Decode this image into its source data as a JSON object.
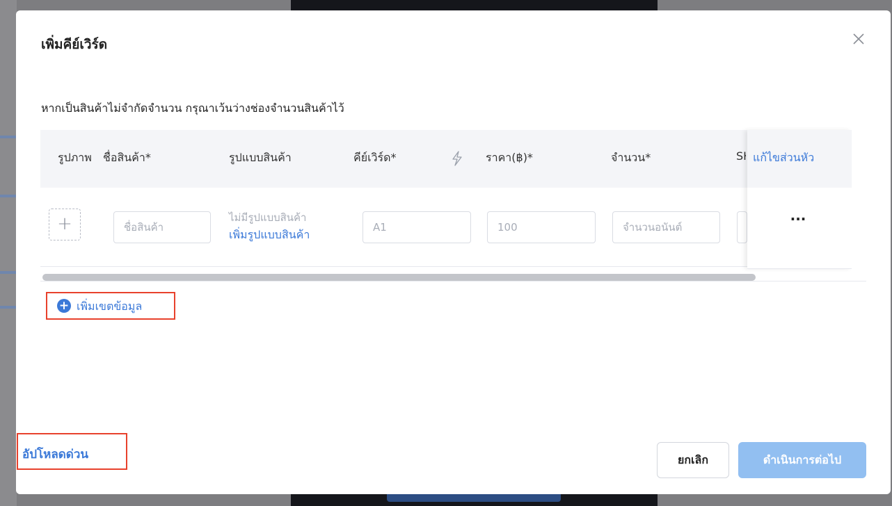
{
  "modal": {
    "title": "เพิ่มคีย์เวิร์ด",
    "hint": "หากเป็นสินค้าไม่จำกัดจำนวน กรุณาเว้นว่างช่องจำนวนสินค้าไว้",
    "table": {
      "headers": {
        "image": "รูปภาพ",
        "product_name": "ชื่อสินค้า*",
        "variant": "รูปแบบสินค้า",
        "keyword": "คีย์เวิร์ด*",
        "price": "ราคา(฿)*",
        "quantity": "จำนวน*",
        "sku_partial": "SK",
        "edit_headers": "แก้ไขส่วนหัว"
      },
      "row": {
        "product_name_placeholder": "ชื่อสินค้า",
        "variant_none": "ไม่มีรูปแบบสินค้า",
        "variant_add": "เพิ่มรูปแบบสินค้า",
        "keyword_placeholder": "A1",
        "price_placeholder": "100",
        "quantity_placeholder": "จำนวนอนันต์",
        "more": "···"
      }
    },
    "add_row_label": "เพิ่มเขตข้อมูล",
    "quick_upload_label": "อัปโหลดด่วน",
    "cancel_label": "ยกเลิก",
    "continue_label": "ดำเนินการต่อไป"
  },
  "colors": {
    "accent": "#3b79d8",
    "continue_disabled": "#92bff1",
    "highlight": "#e8412c"
  },
  "icons": [
    "close-icon",
    "plus-icon",
    "lightning-icon",
    "add-circle-icon",
    "more-icon"
  ]
}
